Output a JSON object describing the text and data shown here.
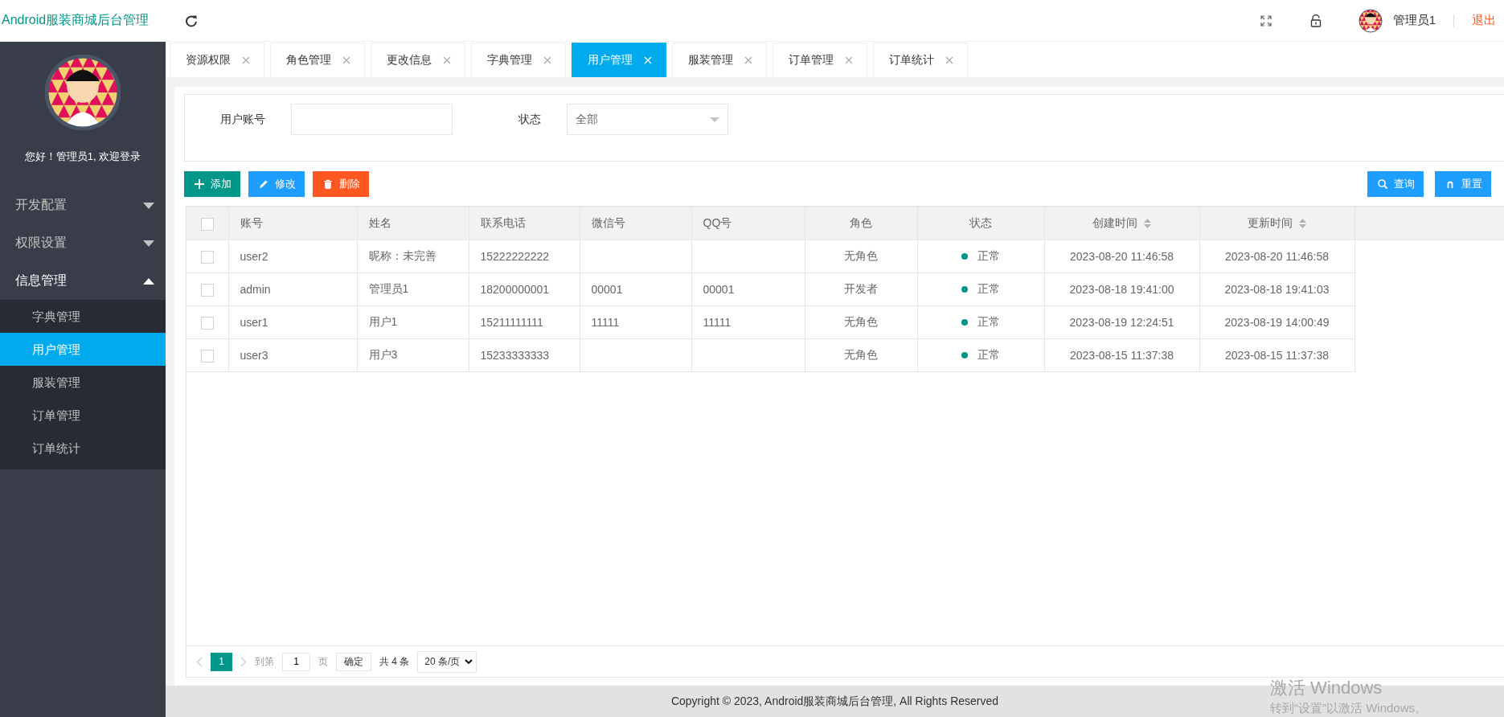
{
  "header": {
    "app_title": "Android服装商城后台管理",
    "user_name": "管理员1",
    "logout": "退出"
  },
  "sidebar": {
    "greeting": "您好！管理员1, 欢迎登录",
    "menu": [
      {
        "label": "开发配置",
        "expanded": false
      },
      {
        "label": "权限设置",
        "expanded": false
      },
      {
        "label": "信息管理",
        "expanded": true,
        "children": [
          {
            "label": "字典管理",
            "selected": false
          },
          {
            "label": "用户管理",
            "selected": true
          },
          {
            "label": "服装管理",
            "selected": false
          },
          {
            "label": "订单管理",
            "selected": false
          },
          {
            "label": "订单统计",
            "selected": false
          }
        ]
      }
    ]
  },
  "tabs": [
    {
      "label": "资源权限",
      "selected": false
    },
    {
      "label": "角色管理",
      "selected": false
    },
    {
      "label": "更改信息",
      "selected": false
    },
    {
      "label": "字典管理",
      "selected": false
    },
    {
      "label": "用户管理",
      "selected": true
    },
    {
      "label": "服装管理",
      "selected": false
    },
    {
      "label": "订单管理",
      "selected": false
    },
    {
      "label": "订单统计",
      "selected": false
    }
  ],
  "search": {
    "fields": [
      {
        "kind": "text",
        "label": "用户账号"
      },
      {
        "kind": "select",
        "label": "状态",
        "value": "全部"
      }
    ]
  },
  "toolbar": {
    "left": [
      {
        "kind": "add",
        "label": "添加"
      },
      {
        "kind": "edit",
        "label": "修改"
      },
      {
        "kind": "delete",
        "label": "删除"
      }
    ],
    "right": [
      {
        "kind": "search",
        "label": "查询"
      },
      {
        "kind": "reset",
        "label": "重置"
      }
    ]
  },
  "table": {
    "all_checked": false,
    "columns": [
      {
        "label": "账号",
        "kind": "text",
        "sortable": false
      },
      {
        "label": "姓名",
        "kind": "text",
        "sortable": false
      },
      {
        "label": "联系电话",
        "kind": "text",
        "sortable": false
      },
      {
        "label": "微信号",
        "kind": "text",
        "sortable": false
      },
      {
        "label": "QQ号",
        "kind": "text",
        "sortable": false
      },
      {
        "label": "角色",
        "kind": "center",
        "sortable": false
      },
      {
        "label": "状态",
        "kind": "status",
        "sortable": false
      },
      {
        "label": "创建时间",
        "kind": "center",
        "sortable": true
      },
      {
        "label": "更新时间",
        "kind": "center",
        "sortable": true
      }
    ],
    "rows": [
      {
        "checked": false,
        "cells": [
          "user2",
          "昵称：未完善",
          "15222222222",
          "",
          "",
          "无角色",
          "正常",
          "2023-08-20 11:46:58",
          "2023-08-20 11:46:58"
        ]
      },
      {
        "checked": false,
        "cells": [
          "admin",
          "管理员1",
          "18200000001",
          "00001",
          "00001",
          "开发者",
          "正常",
          "2023-08-18 19:41:00",
          "2023-08-18 19:41:03"
        ]
      },
      {
        "checked": false,
        "cells": [
          "user1",
          "用户1",
          "15211111111",
          "11111",
          "11111",
          "无角色",
          "正常",
          "2023-08-19 12:24:51",
          "2023-08-19 14:00:49"
        ]
      },
      {
        "checked": false,
        "cells": [
          "user3",
          "用户3",
          "15233333333",
          "",
          "",
          "无角色",
          "正常",
          "2023-08-15 11:37:38",
          "2023-08-15 11:37:38"
        ]
      }
    ]
  },
  "pagination": {
    "current": "1",
    "goto_label": "到第",
    "goto_value": "1",
    "page_unit": "页",
    "confirm": "确定",
    "total": "共 4 条",
    "page_size": "20 条/页"
  },
  "footer": {
    "copyright": "Copyright © 2023, Android服装商城后台管理, All Rights Reserved"
  },
  "os_watermark": {
    "title": "激活 Windows",
    "subtitle": "转到“设置”以激活 Windows。"
  }
}
